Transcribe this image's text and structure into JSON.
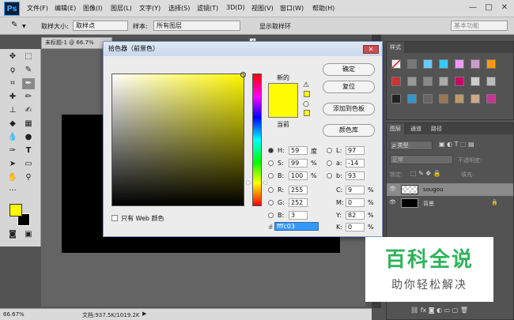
{
  "app": {
    "logo": "Ps"
  },
  "menu": [
    "文件(F)",
    "编辑(E)",
    "图像(I)",
    "图层(L)",
    "文字(Y)",
    "选择(S)",
    "滤镜(T)",
    "3D(D)",
    "视图(V)",
    "窗口(W)",
    "帮助(H)"
  ],
  "window_controls": {
    "minimize": "—",
    "maximize": "□",
    "close": "✕"
  },
  "options_bar": {
    "sample_size_label": "取样大小:",
    "sample_size_value": "取样点",
    "sample_label": "样本:",
    "sample_value": "所有图层",
    "show_ring_label": "显示取样环",
    "workspace": "基本功能"
  },
  "document": {
    "tab_title": "未标题-1 @ 66.7%"
  },
  "status": {
    "zoom": "66.67%",
    "doc_info": "文档:937.5K/1019.2K"
  },
  "tools": [
    "move",
    "marquee",
    "lasso",
    "quick-select",
    "crop",
    "eyedropper",
    "heal",
    "brush",
    "stamp",
    "history-brush",
    "eraser",
    "gradient",
    "blur",
    "dodge",
    "pen",
    "type",
    "path-select",
    "shape",
    "hand",
    "zoom"
  ],
  "colors": {
    "foreground": "#fffc03",
    "background": "#000000"
  },
  "dialog": {
    "title": "拾色器（前景色）",
    "new_label": "新的",
    "current_label": "当前",
    "new_color": "#fffc03",
    "current_color": "#fffc03",
    "buttons": {
      "ok": "确定",
      "reset": "复位",
      "add_swatch": "添加到色板",
      "color_library": "颜色库"
    },
    "web_only_label": "只有 Web 颜色",
    "fields": {
      "H": {
        "label": "H:",
        "value": "59",
        "unit": "度"
      },
      "S": {
        "label": "S:",
        "value": "99",
        "unit": "%"
      },
      "B": {
        "label": "B:",
        "value": "100",
        "unit": "%"
      },
      "R": {
        "label": "R:",
        "value": "255"
      },
      "G": {
        "label": "G:",
        "value": "252"
      },
      "Bv": {
        "label": "B:",
        "value": "3"
      },
      "L": {
        "label": "L:",
        "value": "97"
      },
      "a": {
        "label": "a:",
        "value": "-14"
      },
      "b": {
        "label": "b:",
        "value": "93"
      },
      "C": {
        "label": "C:",
        "value": "9",
        "unit": "%"
      },
      "M": {
        "label": "M:",
        "value": "0",
        "unit": "%"
      },
      "Y": {
        "label": "Y:",
        "value": "82",
        "unit": "%"
      },
      "K": {
        "label": "K:",
        "value": "0",
        "unit": "%"
      },
      "hex": {
        "label": "#",
        "value": "fffc03"
      }
    }
  },
  "styles_panel": {
    "tab": "样式"
  },
  "layers_panel": {
    "tabs": [
      "图层",
      "通道",
      "路径"
    ],
    "filter_label": "ρ 类型",
    "blend_mode": "正常",
    "opacity_label": "不透明度:",
    "lock_label": "锁定:",
    "fill_label": "填充:",
    "layers": [
      {
        "name": "sougou"
      },
      {
        "name": "背景"
      }
    ]
  },
  "watermark": {
    "title": "百科全说",
    "subtitle": "助你轻松解决"
  }
}
